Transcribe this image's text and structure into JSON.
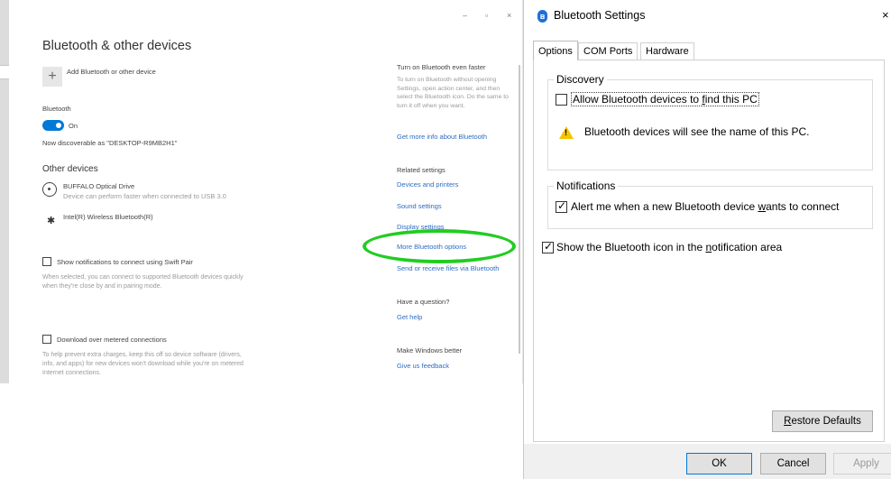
{
  "settings": {
    "window_controls": [
      "–",
      "▫",
      "×"
    ],
    "title": "Bluetooth & other devices",
    "add_label": "Add Bluetooth or other device",
    "add_symbol": "+",
    "bluetooth_label": "Bluetooth",
    "toggle_state": "On",
    "discoverable": "Now discoverable as \"DESKTOP-R9MB2H1\"",
    "other_devices_heading": "Other devices",
    "devices": [
      {
        "name": "BUFFALO Optical Drive",
        "detail": "Device can perform faster when connected to USB 3.0",
        "icon": "optical-drive-icon"
      },
      {
        "name": "Intel(R) Wireless Bluetooth(R)",
        "detail": "",
        "icon": "bluetooth-icon"
      }
    ],
    "swift_pair_label": "Show notifications to connect using Swift Pair",
    "swift_pair_desc": "When selected, you can connect to supported Bluetooth devices quickly when they're close by and in pairing mode.",
    "metered_label": "Download over metered connections",
    "metered_desc": "To help prevent extra charges, keep this off so device software (drivers, info, and apps) for new devices won't download while you're on metered Internet connections.",
    "sidebar": {
      "faster_heading": "Turn on Bluetooth even faster",
      "faster_desc": "To turn on Bluetooth without opening Settings, open action center, and then select the Bluetooth icon. Do the same to turn it off when you want.",
      "faster_link": "Get more info about Bluetooth",
      "related_heading": "Related settings",
      "related_links": [
        "Devices and printers",
        "Sound settings",
        "Display settings",
        "More Bluetooth options",
        "Send or receive files via Bluetooth"
      ],
      "question_heading": "Have a question?",
      "question_link": "Get help",
      "better_heading": "Make Windows better",
      "better_link": "Give us feedback"
    }
  },
  "dialog": {
    "title": "Bluetooth Settings",
    "close": "×",
    "tabs": [
      {
        "label": "Options",
        "active": true
      },
      {
        "label": "COM Ports",
        "active": false
      },
      {
        "label": "Hardware",
        "active": false
      }
    ],
    "discovery": {
      "label": "Discovery",
      "allow_prefix": "Allow Bluetooth devices to ",
      "allow_accel": "f",
      "allow_suffix": "ind this PC",
      "allow_checked": false,
      "warning": "Bluetooth devices will see the name of this PC."
    },
    "notifications": {
      "label": "Notifications",
      "alert_prefix": "Alert me when a new Bluetooth device ",
      "alert_accel": "w",
      "alert_suffix": "ants to connect",
      "alert_checked": true
    },
    "show_icon": {
      "prefix": "Show the Bluetooth icon in the ",
      "accel": "n",
      "suffix": "otification area",
      "checked": true
    },
    "restore_accel": "R",
    "restore_rest": "estore Defaults",
    "buttons": {
      "ok": "OK",
      "cancel": "Cancel",
      "apply": "Apply"
    }
  },
  "colors": {
    "accent": "#0078d7",
    "link": "#2b6cc4",
    "highlight_oval": "#22cc22",
    "warning": "#f3c400"
  }
}
